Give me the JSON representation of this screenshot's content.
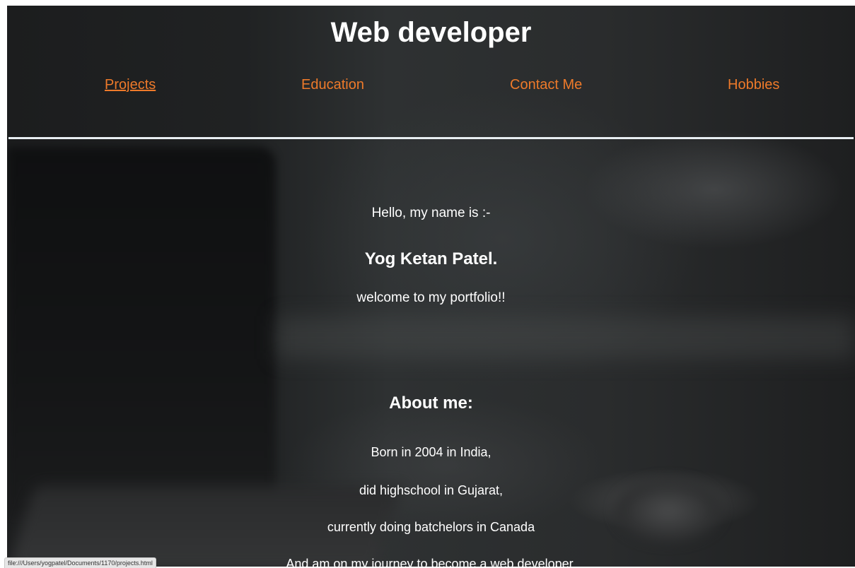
{
  "header": {
    "title": "Web developer"
  },
  "nav": {
    "items": [
      {
        "label": "Projects",
        "active": true
      },
      {
        "label": "Education",
        "active": false
      },
      {
        "label": "Contact Me",
        "active": false
      },
      {
        "label": "Hobbies",
        "active": false
      }
    ]
  },
  "intro": {
    "greeting": "Hello, my name is :-",
    "name": "Yog Ketan Patel.",
    "welcome": "welcome to my portfolio!!"
  },
  "about": {
    "heading": "About me:",
    "lines": [
      "Born in 2004 in India,",
      "did highschool in Gujarat,",
      "currently doing batchelors in Canada",
      "And am on my journey to become a web developer."
    ]
  },
  "status_bar": {
    "url": "file:///Users/yogpatel/Documents/1170/projects.html"
  },
  "colors": {
    "link": "#ee7a2a",
    "text": "#ffffff",
    "divider": "#e8eef2"
  }
}
